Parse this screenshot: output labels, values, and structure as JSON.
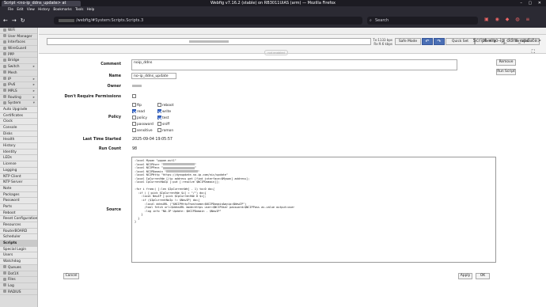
{
  "browser": {
    "tab_title": "Script <no-ip_ddns_update> at",
    "window_title": "Webfig v7.16.2 (stable) on RB3011UiAS (arm) — Mozilla Firefox",
    "menus": [
      "File",
      "Edit",
      "View",
      "History",
      "Bookmarks",
      "Tools",
      "Help"
    ],
    "url": "/webfig/#System:Scripts.Scripts.3",
    "search_placeholder": "Search"
  },
  "sidebar": {
    "items": [
      {
        "label": "WiFi",
        "sub": false
      },
      {
        "label": "User Manager",
        "sub": false
      },
      {
        "label": "Interfaces",
        "sub": false
      },
      {
        "label": "WireGuard",
        "sub": false
      },
      {
        "label": "PPP",
        "sub": false
      },
      {
        "label": "Bridge",
        "sub": false
      },
      {
        "label": "Switch",
        "sub": false,
        "arrow": "▸"
      },
      {
        "label": "Mesh",
        "sub": false
      },
      {
        "label": "IP",
        "sub": false,
        "arrow": "▸"
      },
      {
        "label": "IPv6",
        "sub": false,
        "arrow": "▸"
      },
      {
        "label": "MPLS",
        "sub": false,
        "arrow": "▸"
      },
      {
        "label": "Routing",
        "sub": false,
        "arrow": "▸"
      },
      {
        "label": "System",
        "sub": false,
        "arrow": "▾"
      },
      {
        "label": "Auto Upgrade",
        "sub": true
      },
      {
        "label": "Certificates",
        "sub": true
      },
      {
        "label": "Clock",
        "sub": true
      },
      {
        "label": "Console",
        "sub": true
      },
      {
        "label": "Disks",
        "sub": true
      },
      {
        "label": "Health",
        "sub": true
      },
      {
        "label": "History",
        "sub": true
      },
      {
        "label": "Identity",
        "sub": true
      },
      {
        "label": "LEDs",
        "sub": true
      },
      {
        "label": "License",
        "sub": true
      },
      {
        "label": "Logging",
        "sub": true
      },
      {
        "label": "NTP Client",
        "sub": true
      },
      {
        "label": "NTP Server",
        "sub": true
      },
      {
        "label": "Note",
        "sub": true
      },
      {
        "label": "Packages",
        "sub": true
      },
      {
        "label": "Password",
        "sub": true
      },
      {
        "label": "Ports",
        "sub": true
      },
      {
        "label": "Reboot",
        "sub": true
      },
      {
        "label": "Reset Configuration",
        "sub": true
      },
      {
        "label": "Resources",
        "sub": true
      },
      {
        "label": "RouterBOARD",
        "sub": true
      },
      {
        "label": "Scheduler",
        "sub": true
      },
      {
        "label": "Scripts",
        "sub": true,
        "selected": true
      },
      {
        "label": "Special Login",
        "sub": true
      },
      {
        "label": "Users",
        "sub": true
      },
      {
        "label": "Watchdog",
        "sub": true
      },
      {
        "label": "Queues",
        "sub": false
      },
      {
        "label": "Dot1X",
        "sub": false
      },
      {
        "label": "Files",
        "sub": false
      },
      {
        "label": "Log",
        "sub": false
      },
      {
        "label": "RADIUS",
        "sub": false
      }
    ]
  },
  "header": {
    "tx": "Tx:1133 bps",
    "rx": "Rx:9.6 kbps",
    "safe_mode": "Safe Mode",
    "undo": "↶",
    "redo": "↷",
    "quick_set": "Quick Set",
    "webfig": "WebFig",
    "terminal": "Terminal"
  },
  "page": {
    "title": "Script <no-ip_ddns_update>",
    "not_enabled": "not enabled",
    "expand_icon": "⛶"
  },
  "form": {
    "comment_label": "Comment",
    "comment_value": "noip_ddns",
    "name_label": "Name",
    "name_value": "no-ip_ddns_update",
    "owner_label": "Owner",
    "dont_require_label": "Don't Require Permissions",
    "policy_label": "Policy",
    "policies": [
      {
        "label": "ftp",
        "checked": false
      },
      {
        "label": "reboot",
        "checked": false
      },
      {
        "label": "read",
        "checked": true
      },
      {
        "label": "write",
        "checked": true
      },
      {
        "label": "policy",
        "checked": false
      },
      {
        "label": "test",
        "checked": true
      },
      {
        "label": "password",
        "checked": false
      },
      {
        "label": "sniff",
        "checked": false
      },
      {
        "label": "sensitive",
        "checked": false
      },
      {
        "label": "romon",
        "checked": false
      }
    ],
    "last_started_label": "Last Time Started",
    "last_started_value": "2025-09-04 19:05:57",
    "run_count_label": "Run Count",
    "run_count_value": "98",
    "source_label": "Source",
    "source_lines": [
      ":local Mywan \"pppoe-out1\"",
      ":local NCIPUser \"",
      ":local NCIPPass \"",
      ":local NCIPDomain \"",
      ":local NCIPHttp \"https://dynupdate.no-ip.com/nic/update\"",
      ":local IpCurrentWe [/ip address get [find interface=$Mywan] address];",
      ":local IpCurrentNoIp [:put [:resolve $NCIPDomain]];",
      "",
      ":for i from=( [:len $IpCurrentWe] - 1) to=0 do={",
      "  :if ( [:pick $IpCurrentWe $i] = \"/\") do={",
      "    :local NewIP [:pick $IpCurrentWe 0 $i];",
      "    :if ($IpCurrentNoIp != $NewIP) do={",
      "      :local ddnsURL (\"$NCIPHttp?hostname=$NCIPDomain&myip=$NewIP\")",
      "      /tool fetch url=$ddnsURL mode=https user=$NCIPUser password=$NCIPPass as-value output=user",
      "      :log info \"NO-IP Update: $NCIPDomain - $NewIP\"",
      "    }",
      "  }",
      "}"
    ]
  },
  "buttons": {
    "remove": "Remove",
    "run_script": "Run Script",
    "cancel": "Cancel",
    "apply": "Apply",
    "ok": "OK"
  }
}
